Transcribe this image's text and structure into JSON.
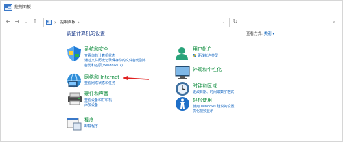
{
  "window": {
    "title": "控制面板"
  },
  "address_bar": {
    "crumb": "控制面板",
    "separator": "›"
  },
  "search": {
    "placeholder": ""
  },
  "main": {
    "heading": "调整计算机的设置",
    "view_by_label": "查看方式:",
    "view_by_value": "类别 ▾"
  },
  "categories": {
    "system_security": {
      "title": "系统和安全",
      "links": [
        "查看你的计算机状态",
        "通过文件历史记录保存你的文件备份副本",
        "备份和还原(Windows 7)"
      ]
    },
    "network": {
      "title": "网络和 Internet",
      "links": [
        "查看网络状态和任务"
      ]
    },
    "hardware_sound": {
      "title": "硬件和声音",
      "links": [
        "查看设备和打印机",
        "添加设备"
      ]
    },
    "programs": {
      "title": "程序",
      "links": [
        "卸载程序"
      ]
    },
    "user_accounts": {
      "title": "用户帐户",
      "links": [
        "更改帐户类型"
      ]
    },
    "appearance": {
      "title": "外观和个性化",
      "links": []
    },
    "clock_region": {
      "title": "时钟和区域",
      "links": [
        "更改日期、时间或数字格式"
      ]
    },
    "ease_access": {
      "title": "轻松使用",
      "links": [
        "使用 Windows 建议的设置",
        "优化视频显示"
      ]
    }
  },
  "colors": {
    "category_title": "#0a8a3a",
    "link": "#1064c0",
    "heading": "#1a3a8a",
    "annotation_arrow": "#e02020"
  }
}
